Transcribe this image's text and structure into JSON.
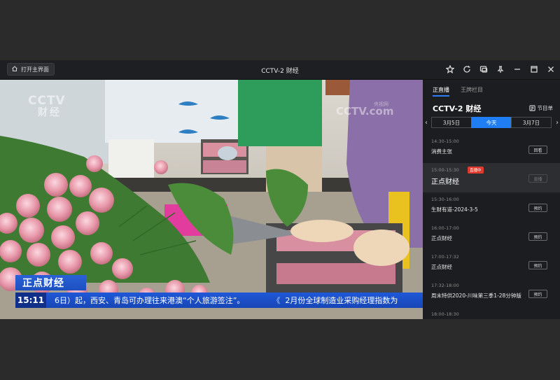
{
  "titlebar": {
    "home_label": "打开主界面",
    "title": "CCTV-2 财经"
  },
  "video": {
    "logo_left_main": "CCTV",
    "logo_left_sub": "财经",
    "logo_right_main": "CCTV.com",
    "logo_right_sub": "央视网",
    "program_label": "正点财经",
    "ticker_time": "15:11",
    "ticker_text_1": "6日）起，西安、青岛可办理往来港澳“个人旅游签注”。",
    "ticker_separator": "《",
    "ticker_text_2": "2月份全球制造业采购经理指数为"
  },
  "sidebar": {
    "tabs": [
      {
        "label": "正直播",
        "active": true
      },
      {
        "label": "王牌栏目",
        "active": false
      }
    ],
    "channel_name": "CCTV-2 财经",
    "schedule_label": "节目单",
    "dates": [
      {
        "label": "3月5日",
        "active": false
      },
      {
        "label": "今天",
        "active": true
      },
      {
        "label": "3月7日",
        "active": false
      }
    ],
    "programs": [
      {
        "time": "14:30-15:00",
        "title": "消费主张",
        "button": "回看",
        "live": false
      },
      {
        "time": "15:00-15:30",
        "title": "正点财经",
        "button": "直播",
        "live": true,
        "badge": "直播中"
      },
      {
        "time": "15:30-16:00",
        "title": "生财有道-2024-3-5",
        "button": "预约",
        "live": false
      },
      {
        "time": "16:00-17:00",
        "title": "正点财经",
        "button": "预约",
        "live": false
      },
      {
        "time": "17:00-17:32",
        "title": "正点财经",
        "button": "预约",
        "live": false
      },
      {
        "time": "17:32-18:00",
        "title": "周末特供2020-川味第三季1-28分钟版",
        "button": "预约",
        "live": false
      },
      {
        "time": "18:00-18:30",
        "title": "",
        "button": "",
        "live": false
      }
    ]
  },
  "colors": {
    "accent": "#1f7ef3",
    "live_badge": "#e03a2f",
    "ticker_blue": "#1f58d8"
  }
}
